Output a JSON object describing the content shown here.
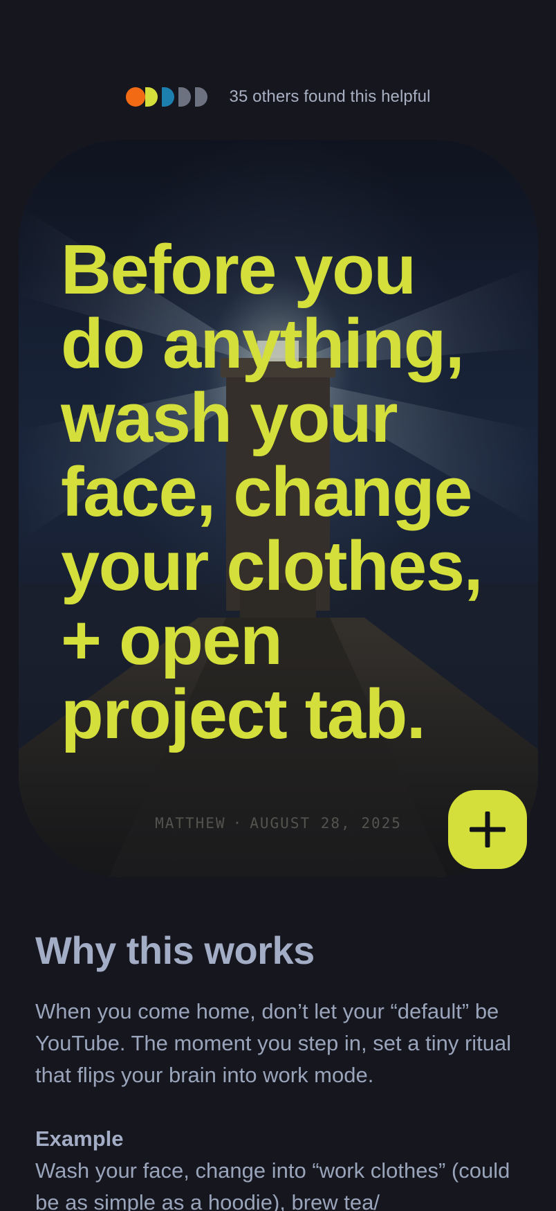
{
  "helpful": {
    "avatar_colors": [
      "#f26a13",
      "#d4df3b",
      "#1d7fae",
      "#6c7280",
      "#6c7280"
    ],
    "text": "35 others found this helpful"
  },
  "card": {
    "quote_lines": [
      "Before you",
      "do anything,",
      "wash your",
      "face, change",
      "your clothes,",
      "+ open",
      "project tab."
    ],
    "author": "MATTHEW",
    "separator": "·",
    "date": "AUGUST 28, 2025",
    "accent_color": "#d4df3b",
    "background_image": "lighthouse-at-night"
  },
  "add_button": {
    "icon": "plus-icon"
  },
  "why": {
    "title": "Why this works",
    "body": "When you come home, don’t let your “default” be YouTube. The moment you step in, set a tiny ritual that flips your brain into work mode.",
    "example_label": "Example",
    "example_body": "Wash your face, change into “work clothes” (could be as simple as a hoodie), brew tea/"
  }
}
